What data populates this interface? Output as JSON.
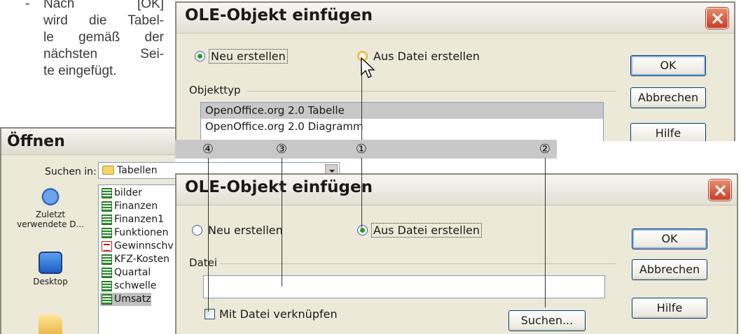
{
  "doc_text": {
    "dash": "-",
    "lines": [
      "Nach        [OK]",
      "wird die Tabel-",
      "le gemäß der",
      "nächsten Sei-",
      "te eingefügt."
    ]
  },
  "dialog_top": {
    "title": "OLE-Objekt einfügen",
    "radio_new": "Neu erstellen",
    "radio_file": "Aus Datei erstellen",
    "group_label": "Objekttyp",
    "list_items": [
      "OpenOffice.org 2.0 Tabelle",
      "OpenOffice.org 2.0 Diagramm"
    ],
    "ok": "OK",
    "cancel": "Abbrechen",
    "help": "Hilfe"
  },
  "callouts": {
    "n4": "④",
    "n3": "③",
    "n1": "①",
    "n2": "②"
  },
  "open_dialog": {
    "title": "Öffnen",
    "lookin_label": "Suchen in:",
    "lookin_value": "Tabellen",
    "places": [
      {
        "icon": "recent-documents-icon",
        "label_line1": "Zuletzt",
        "label_line2": "verwendete D..."
      },
      {
        "icon": "desktop-icon",
        "label_line1": "Desktop",
        "label_line2": ""
      },
      {
        "icon": "my-documents-icon",
        "label_line1": "",
        "label_line2": ""
      }
    ],
    "files": [
      {
        "name": "bilder",
        "icon": "spreadsheet-icon"
      },
      {
        "name": "Finanzen",
        "icon": "spreadsheet-icon"
      },
      {
        "name": "Finanzen1",
        "icon": "spreadsheet-icon"
      },
      {
        "name": "Funktionen",
        "icon": "spreadsheet-icon"
      },
      {
        "name": "Gewinnschv",
        "icon": "pdf-icon"
      },
      {
        "name": "KFZ-Kosten",
        "icon": "spreadsheet-icon"
      },
      {
        "name": "Quartal",
        "icon": "spreadsheet-icon"
      },
      {
        "name": "schwelle",
        "icon": "spreadsheet-icon"
      },
      {
        "name": "Umsatz",
        "icon": "spreadsheet-icon"
      }
    ]
  },
  "dialog_bottom": {
    "title": "OLE-Objekt einfügen",
    "radio_new": "Neu erstellen",
    "radio_file": "Aus Datei erstellen",
    "group_label": "Datei",
    "file_value": "",
    "link_checkbox": "Mit Datei verknüpfen",
    "browse": "Suchen...",
    "ok": "OK",
    "cancel": "Abbrechen",
    "help": "Hilfe"
  },
  "colors": {
    "dialog_bg": "#ece9d8",
    "close_red": "#c8402a",
    "radio_checked": "#21a121",
    "callout_bar": "#c8c8c8",
    "list_selection": "#c8c8c8"
  }
}
